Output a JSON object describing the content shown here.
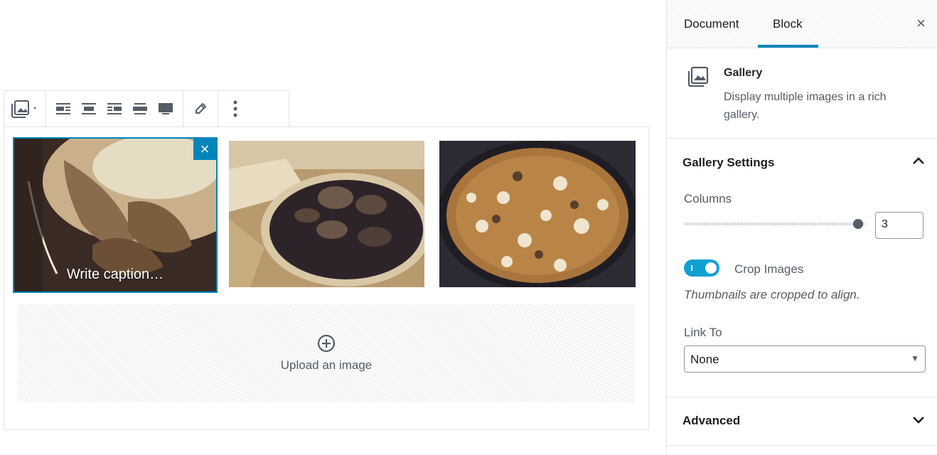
{
  "editor": {
    "gallery": {
      "selected_caption_placeholder": "Write caption…",
      "remove_label": "×",
      "upload_label": "Upload an image"
    }
  },
  "sidebar": {
    "tabs": [
      {
        "label": "Document"
      },
      {
        "label": "Block"
      }
    ],
    "active_tab": "Block",
    "close_label": "×",
    "block_card": {
      "title": "Gallery",
      "description": "Display multiple images in a rich gallery."
    },
    "gallery_settings": {
      "title": "Gallery Settings",
      "columns_label": "Columns",
      "columns_value": "3",
      "columns_slider_fraction": 0.95,
      "crop_label": "Crop Images",
      "crop_enabled": true,
      "crop_help": "Thumbnails are cropped to align.",
      "link_to_label": "Link To",
      "link_to_value": "None"
    },
    "advanced": {
      "title": "Advanced"
    }
  },
  "colors": {
    "accent": "#0085ba",
    "toggle_on": "#11a0d2",
    "icon": "#555d66"
  }
}
